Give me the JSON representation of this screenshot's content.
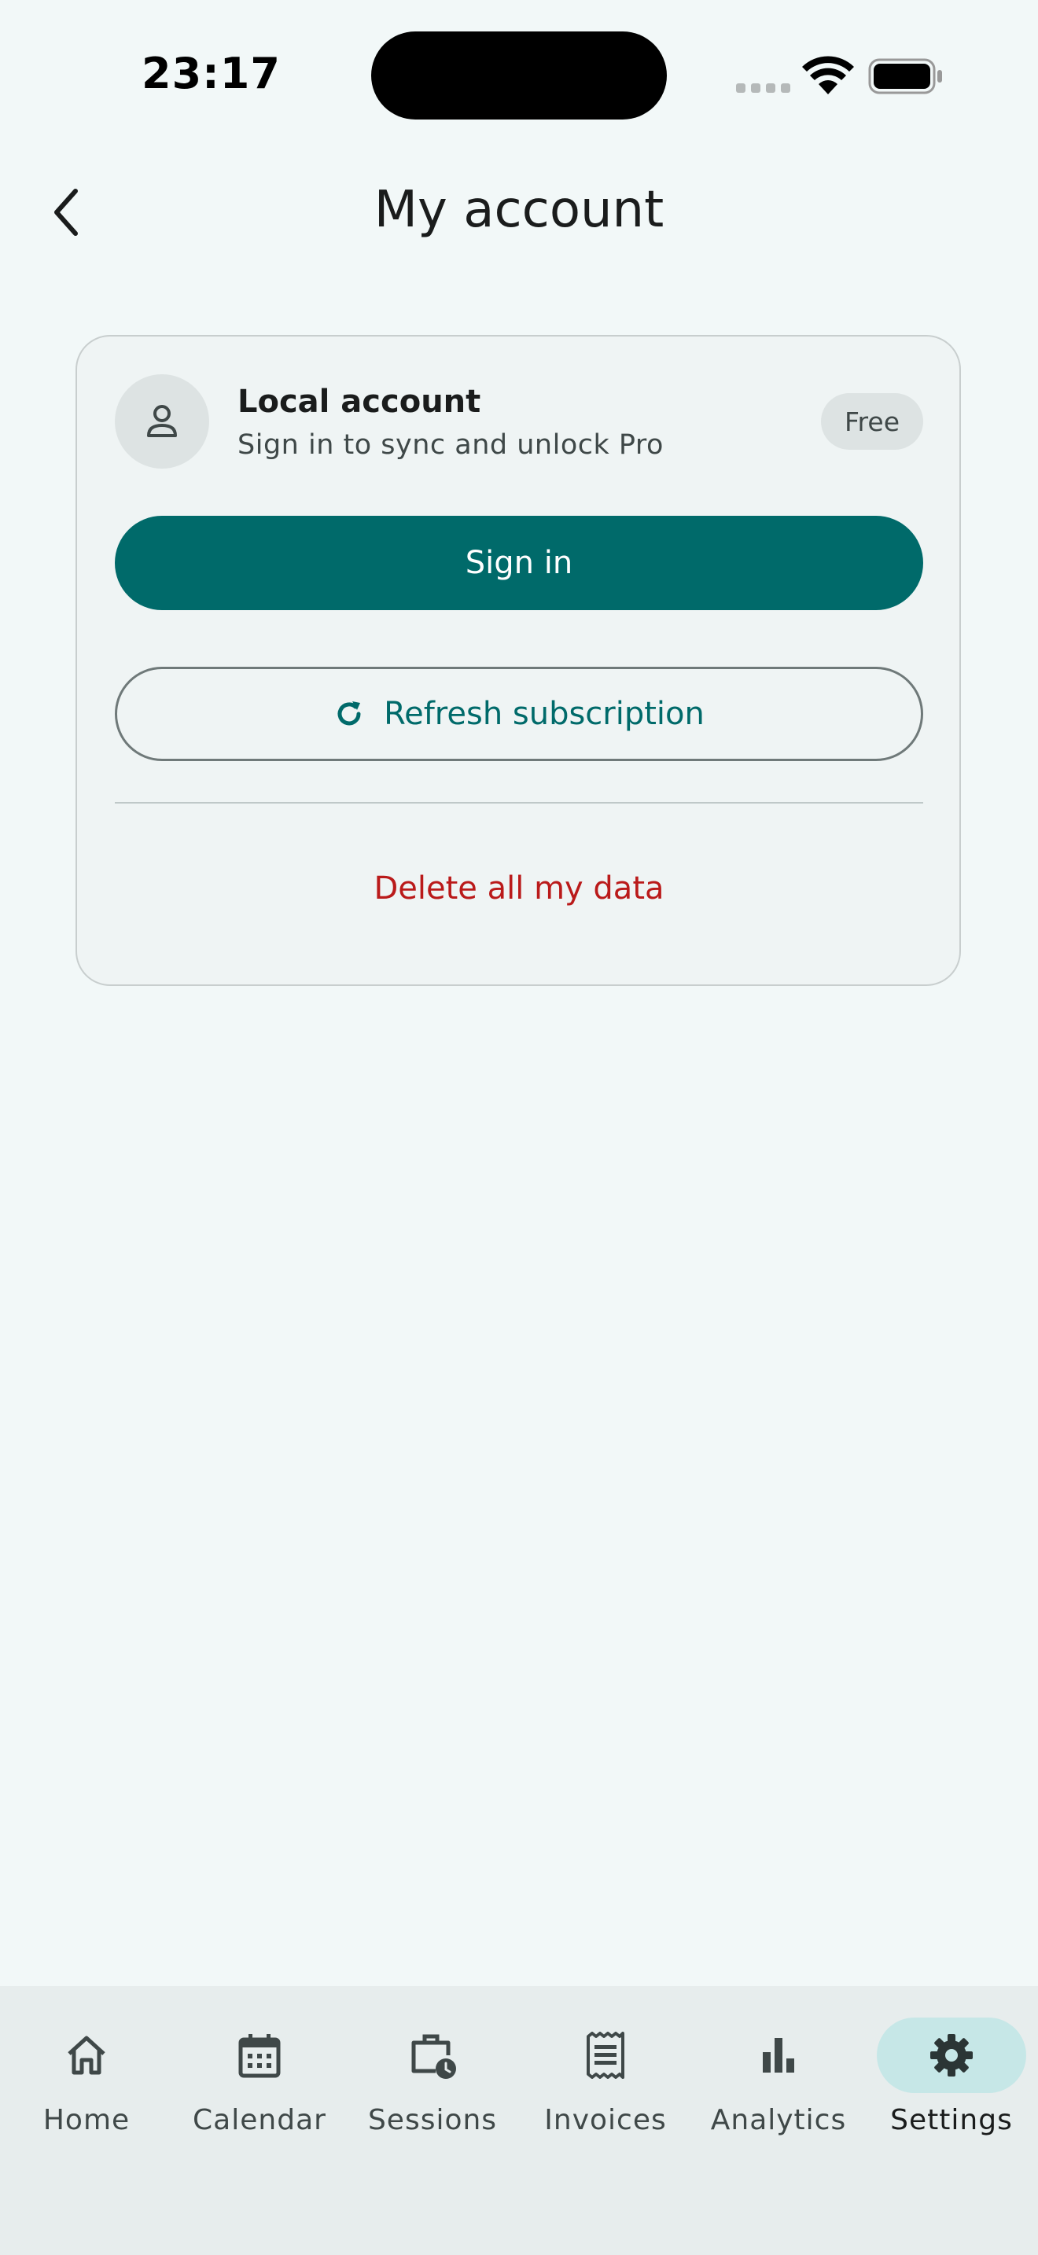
{
  "status_bar": {
    "time": "23:17"
  },
  "header": {
    "title": "My account"
  },
  "account": {
    "name": "Local account",
    "subtitle": "Sign in to sync and unlock Pro",
    "plan_badge": "Free",
    "sign_in_label": "Sign in",
    "refresh_label": "Refresh subscription",
    "delete_label": "Delete all my data"
  },
  "colors": {
    "primary": "#006a6a",
    "danger": "#ba1a1a",
    "background": "#f2f8f8",
    "nav_active_indicator": "#c6e7e7"
  },
  "nav": {
    "active": "Settings",
    "items": [
      {
        "label": "Home",
        "icon": "home-icon"
      },
      {
        "label": "Calendar",
        "icon": "calendar-icon"
      },
      {
        "label": "Sessions",
        "icon": "briefcase-clock-icon"
      },
      {
        "label": "Invoices",
        "icon": "receipt-icon"
      },
      {
        "label": "Analytics",
        "icon": "bar-chart-icon"
      },
      {
        "label": "Settings",
        "icon": "gear-icon"
      }
    ]
  }
}
